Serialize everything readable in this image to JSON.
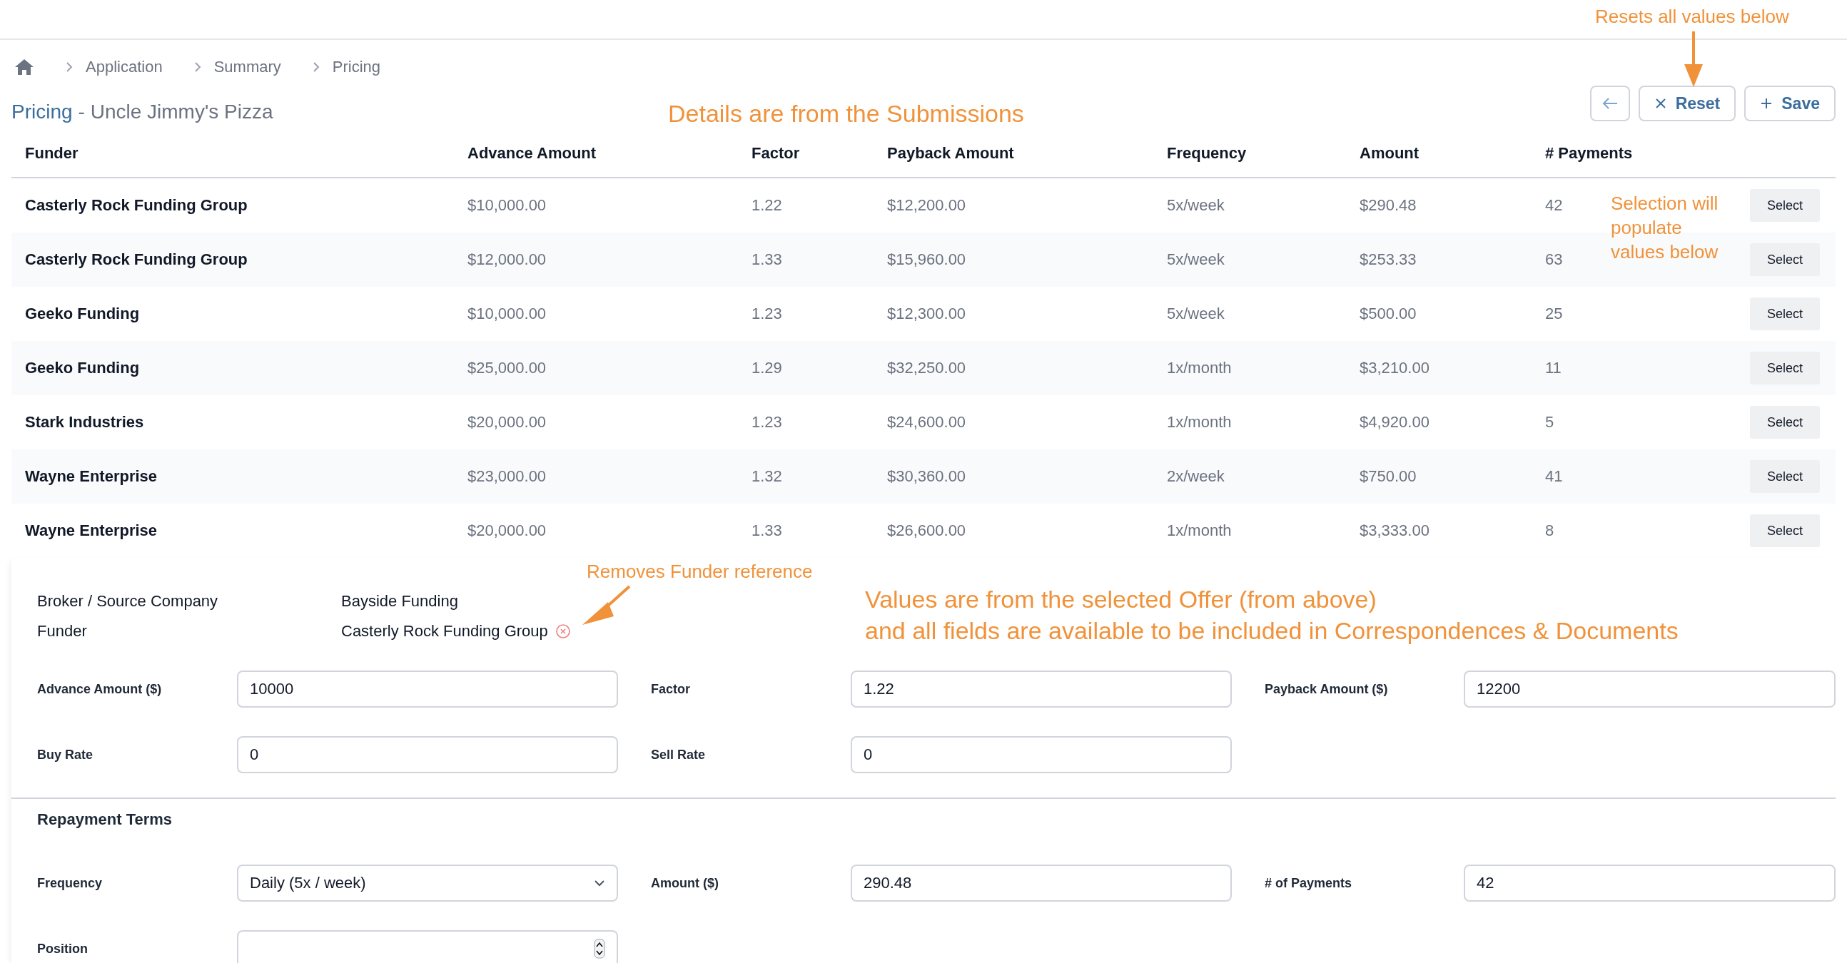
{
  "breadcrumb": [
    "Application",
    "Summary",
    "Pricing"
  ],
  "title": {
    "section": "Pricing",
    "name": "- Uncle Jimmy's Pizza"
  },
  "toolbar": [
    {
      "kind": "back"
    },
    {
      "kind": "reset",
      "label": "Reset"
    },
    {
      "kind": "save",
      "label": "Save"
    }
  ],
  "table": {
    "columns": [
      "Funder",
      "Advance Amount",
      "Factor",
      "Payback Amount",
      "Frequency",
      "Amount",
      "# Payments"
    ],
    "rows": [
      {
        "cells": [
          "Casterly Rock Funding Group",
          "$10,000.00",
          "1.22",
          "$12,200.00",
          "5x/week",
          "$290.48",
          "42"
        ],
        "action": "Select"
      },
      {
        "cells": [
          "Casterly Rock Funding Group",
          "$12,000.00",
          "1.33",
          "$15,960.00",
          "5x/week",
          "$253.33",
          "63"
        ],
        "action": "Select"
      },
      {
        "cells": [
          "Geeko Funding",
          "$10,000.00",
          "1.23",
          "$12,300.00",
          "5x/week",
          "$500.00",
          "25"
        ],
        "action": "Select"
      },
      {
        "cells": [
          "Geeko Funding",
          "$25,000.00",
          "1.29",
          "$32,250.00",
          "1x/month",
          "$3,210.00",
          "11"
        ],
        "action": "Select"
      },
      {
        "cells": [
          "Stark Industries",
          "$20,000.00",
          "1.23",
          "$24,600.00",
          "1x/month",
          "$4,920.00",
          "5"
        ],
        "action": "Select"
      },
      {
        "cells": [
          "Wayne Enterprise",
          "$23,000.00",
          "1.32",
          "$30,360.00",
          "2x/week",
          "$750.00",
          "41"
        ],
        "action": "Select"
      },
      {
        "cells": [
          "Wayne Enterprise",
          "$20,000.00",
          "1.33",
          "$26,600.00",
          "1x/month",
          "$3,333.00",
          "8"
        ],
        "action": "Select"
      }
    ]
  },
  "offer": {
    "info": [
      {
        "label": "Broker / Source Company",
        "value": "Bayside Funding",
        "removable": false
      },
      {
        "label": "Funder",
        "value": "Casterly Rock Funding Group",
        "removable": true
      }
    ],
    "rows": [
      [
        {
          "label": "Advance Amount ($)",
          "value": "10000",
          "kind": "text"
        },
        {
          "label": "Factor",
          "value": "1.22",
          "kind": "text"
        },
        {
          "label": "Payback Amount ($)",
          "value": "12200",
          "kind": "text"
        }
      ],
      [
        {
          "label": "Buy Rate",
          "value": "0",
          "kind": "text"
        },
        {
          "label": "Sell Rate",
          "value": "0",
          "kind": "text"
        }
      ]
    ],
    "section": "Repayment Terms",
    "terms": [
      [
        {
          "label": "Frequency",
          "value": "Daily (5x / week)",
          "kind": "select"
        },
        {
          "label": "Amount ($)",
          "value": "290.48",
          "kind": "text"
        },
        {
          "label": "# of Payments",
          "value": "42",
          "kind": "text"
        }
      ],
      [
        {
          "label": "Position",
          "kind": "number"
        }
      ]
    ]
  },
  "annotations": [
    {
      "kind": "reset",
      "text": "Resets all values below"
    },
    {
      "kind": "details",
      "text": "Details are from the Submissions"
    },
    {
      "kind": "selection",
      "text": "Selection will\npopulate\nvalues below"
    },
    {
      "kind": "funder",
      "text": "Removes Funder reference"
    },
    {
      "kind": "values",
      "text": "Values are from the selected Offer (from above)\nand all fields are available to be included in Correspondences & Documents"
    }
  ]
}
